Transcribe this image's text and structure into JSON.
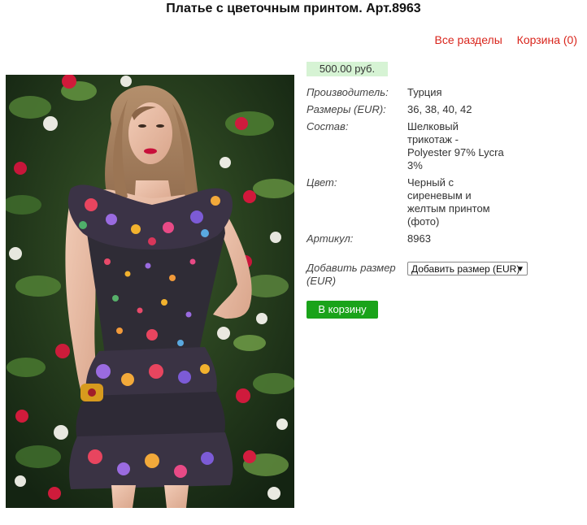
{
  "page": {
    "title": "Платье с цветочным принтом. Арт.8963"
  },
  "nav": {
    "all_sections": "Все разделы",
    "cart": "Корзина (0)"
  },
  "product": {
    "price": "500.00 руб.",
    "specs": [
      {
        "label": "Производитель:",
        "value": "Турция"
      },
      {
        "label": "Размеры (EUR):",
        "value": "36, 38, 40, 42"
      },
      {
        "label": "Состав:",
        "value": "Шелковый трикотаж - Polyester 97% Lycra 3%"
      },
      {
        "label": "Цвет:",
        "value": "Черный с сиреневым и желтым принтом (фото)"
      },
      {
        "label": "Артикул:",
        "value": "8963"
      }
    ],
    "add_size_label": "Добавить размер (EUR)",
    "size_select_value": "Добавить размер (EUR)",
    "cart_button": "В корзину"
  },
  "colors": {
    "price_bg": "#d6f3d4",
    "link": "#d9251c",
    "button": "#1aa31a"
  }
}
